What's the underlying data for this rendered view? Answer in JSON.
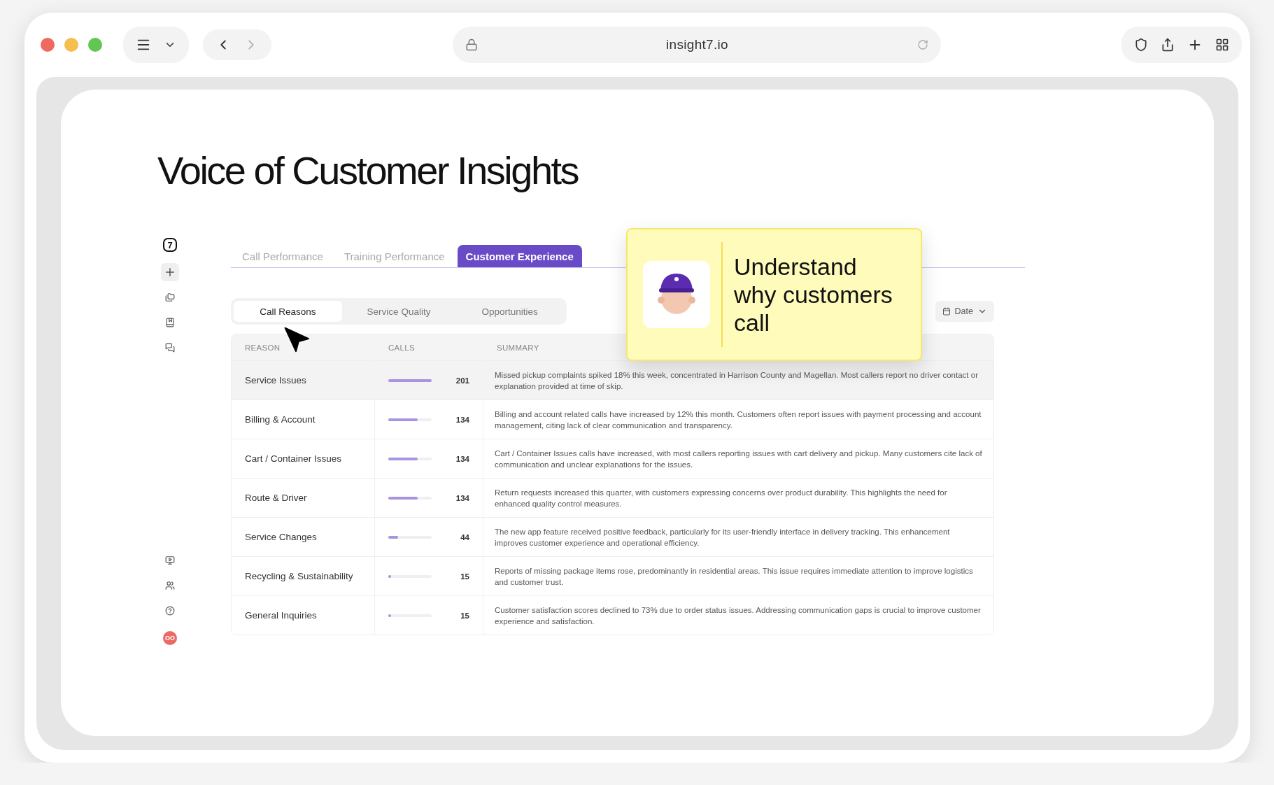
{
  "browser": {
    "url": "insight7.io"
  },
  "page": {
    "title": "Voice of Customer Insights"
  },
  "sidebar": {
    "logo": "7",
    "user_initials": "OO"
  },
  "tabs": [
    {
      "label": "Call Performance",
      "selected": false
    },
    {
      "label": "Training Performance",
      "selected": false
    },
    {
      "label": "Customer Experience",
      "selected": true
    }
  ],
  "sub_tabs": [
    {
      "label": "Call Reasons",
      "selected": true
    },
    {
      "label": "Service Quality",
      "selected": false
    },
    {
      "label": "Opportunities",
      "selected": false
    }
  ],
  "date_filter": {
    "label": "Date"
  },
  "table": {
    "columns": [
      "REASON",
      "CALLS",
      "SUMMARY"
    ],
    "rows": [
      {
        "reason": "Service Issues",
        "calls": "201",
        "level": 1,
        "highlighted": true,
        "summary": "Missed pickup complaints spiked 18% this week, concentrated in Harrison County and Magellan. Most callers report no driver contact or explanation provided at time of skip."
      },
      {
        "reason": "Billing & Account",
        "calls": "134",
        "level": 0.67,
        "highlighted": false,
        "summary": "Billing and account related calls have increased by 12% this month. Customers often report issues with payment processing and account management, citing lack of clear communication and transparency."
      },
      {
        "reason": "Cart / Container Issues",
        "calls": "134",
        "level": 0.67,
        "highlighted": false,
        "summary": "Cart / Container Issues calls have increased, with most callers reporting issues with cart delivery and pickup. Many customers cite lack of communication and unclear explanations for the issues."
      },
      {
        "reason": "Route & Driver",
        "calls": "134",
        "level": 0.67,
        "highlighted": false,
        "summary": "Return requests increased this quarter, with customers expressing concerns over product durability. This highlights the need for enhanced quality control measures."
      },
      {
        "reason": "Service Changes",
        "calls": "44",
        "level": 0.22,
        "highlighted": false,
        "summary": "The new app feature received positive feedback, particularly for its user-friendly interface in delivery tracking. This enhancement improves customer experience and operational efficiency."
      },
      {
        "reason": "Recycling & Sustainability",
        "calls": "15",
        "level": 0.05,
        "highlighted": false,
        "summary": "Reports of missing package items rose, predominantly in residential areas. This issue requires immediate attention to improve logistics and customer trust."
      },
      {
        "reason": "General Inquiries",
        "calls": "15",
        "level": 0.05,
        "highlighted": false,
        "summary": "Customer satisfaction scores declined to 73% due to order status issues. Addressing communication gaps is crucial to improve customer experience and satisfaction."
      }
    ]
  },
  "callout": {
    "text": "Understand why customers call"
  }
}
